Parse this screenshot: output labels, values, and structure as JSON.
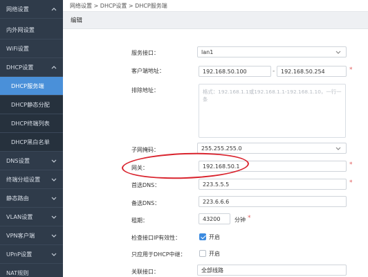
{
  "breadcrumb": "网络设置 > DHCP设置 > DHCP服务端",
  "section_title": "编辑",
  "sidebar": {
    "items": [
      {
        "label": "网络设置",
        "chevron": "up"
      },
      {
        "label": "内外网设置"
      },
      {
        "label": "WiFi设置"
      },
      {
        "label": "DHCP设置",
        "chevron": "up"
      },
      {
        "label": "DHCP服务端",
        "active": true
      },
      {
        "label": "DHCP静态分配"
      },
      {
        "label": "DHCP终端列表"
      },
      {
        "label": "DHCP黑白名单"
      },
      {
        "label": "DNS设置",
        "chevron": "down"
      },
      {
        "label": "终端分组设置",
        "chevron": "down"
      },
      {
        "label": "静态路由",
        "chevron": "down"
      },
      {
        "label": "VLAN设置",
        "chevron": "down"
      },
      {
        "label": "VPN客户端",
        "chevron": "down"
      },
      {
        "label": "UPnP设置",
        "chevron": "down"
      },
      {
        "label": "NAT规则"
      }
    ]
  },
  "form": {
    "service_interface_label": "服务接口：",
    "service_interface_value": "lan1",
    "client_address_label": "客户端地址：",
    "client_address_start": "192.168.50.100",
    "client_address_end": "192.168.50.254",
    "exclude_label": "排除地址：",
    "exclude_placeholder": "格式：192.168.1.1或192.168.1.1-192.168.1.10，一行一条",
    "subnet_mask_label": "子网掩码：",
    "subnet_mask_value": "255.255.255.0",
    "gateway_label": "网关：",
    "gateway_value": "192.168.50.1",
    "primary_dns_label": "首选DNS：",
    "primary_dns_value": "223.5.5.5",
    "secondary_dns_label": "备选DNS：",
    "secondary_dns_value": "223.6.6.6",
    "lease_label": "租期：",
    "lease_value": "43200",
    "lease_unit": "分钟",
    "check_ip_label": "检查接口IP有效性：",
    "check_ip_checked": true,
    "check_ip_text": "开启",
    "dhcp_relay_label": "只应用于DHCP中继：",
    "dhcp_relay_checked": false,
    "dhcp_relay_text": "开启",
    "linked_interface_label": "关联接口：",
    "linked_interface_value": "全部线路",
    "required_mark": "*",
    "range_dash": "-"
  },
  "colors": {
    "sidebar_bg": "#2f3b4a",
    "active": "#4a90d9",
    "annotation": "#d9232d"
  }
}
